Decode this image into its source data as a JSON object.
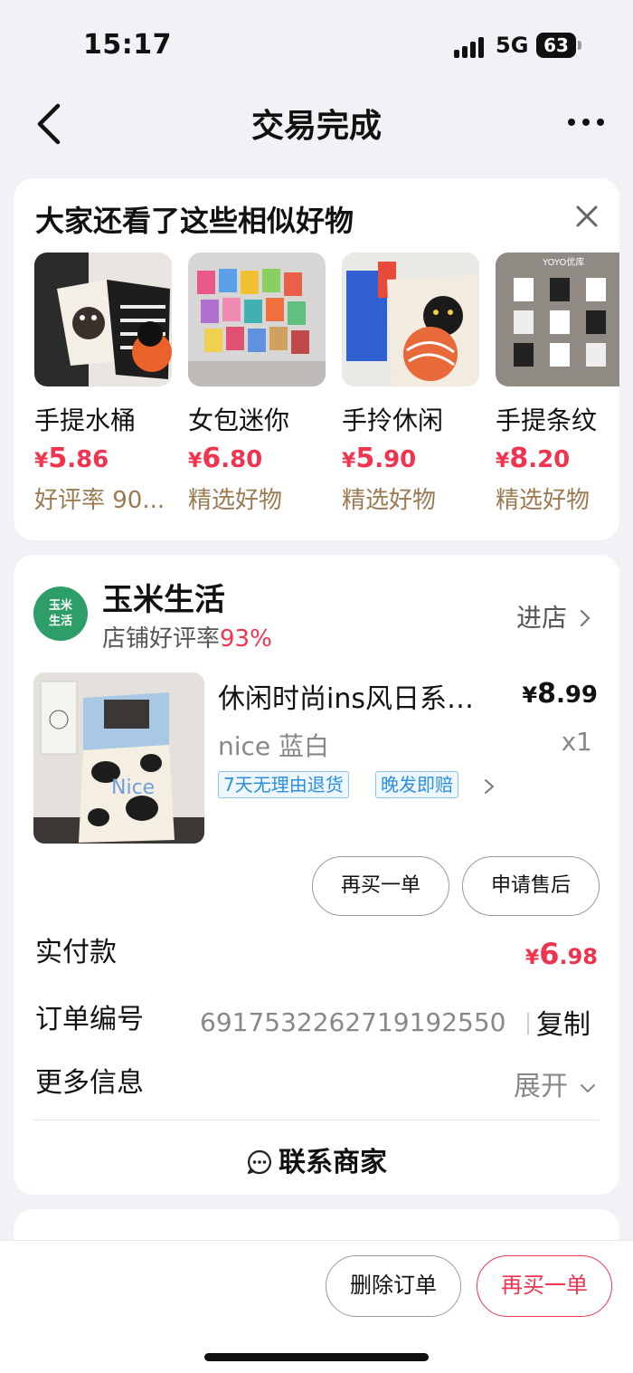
{
  "status_bar": {
    "time": "15:17",
    "network": "5G",
    "battery": "63"
  },
  "nav": {
    "title": "交易完成"
  },
  "recommend": {
    "title": "大家还看了这些相似好物",
    "items": [
      {
        "name": "手提水桶",
        "price_yen": "¥",
        "price_int": "5",
        "price_dec": ".86",
        "tag": "好评率 90..."
      },
      {
        "name": "女包迷你",
        "price_yen": "¥",
        "price_int": "6",
        "price_dec": ".80",
        "tag": "精选好物"
      },
      {
        "name": "手拎休闲",
        "price_yen": "¥",
        "price_int": "5",
        "price_dec": ".90",
        "tag": "精选好物"
      },
      {
        "name": "手提条纹",
        "price_yen": "¥",
        "price_int": "8",
        "price_dec": ".20",
        "tag": "精选好物"
      }
    ],
    "item4_banner": "YOYO优库"
  },
  "shop": {
    "logo_line1": "玉米",
    "logo_line2": "生活",
    "name": "玉米生活",
    "rating_label": "店铺好评率",
    "rating_value": "93%",
    "enter_label": "进店"
  },
  "product": {
    "title": "休闲时尚ins风日系小众针织",
    "price_yen": "¥",
    "price_int": "8",
    "price_dec": ".99",
    "spec": "nice 蓝白",
    "qty": "x1",
    "badge1": "7天无理由退货",
    "badge2": "晚发即赔",
    "img_text": "Nice"
  },
  "actions": {
    "rebuy_label": "再买一单",
    "after_sale_label": "申请售后"
  },
  "payment": {
    "paid_label": "实付款",
    "paid_yen": "¥",
    "paid_int": "6",
    "paid_dec": ".98",
    "order_no_label": "订单编号",
    "order_no": "6917532262719192550",
    "copy_label": "复制",
    "more_info_label": "更多信息",
    "expand_label": "展开"
  },
  "contact_label": "联系商家",
  "bottom_bar": {
    "delete_label": "删除订单",
    "rebuy_label": "再买一单"
  },
  "colors": {
    "accent_red": "#f0344f",
    "tag_brown": "#9b7a52",
    "badge_blue": "#2a8fe0",
    "shop_green": "#2e9e68"
  }
}
